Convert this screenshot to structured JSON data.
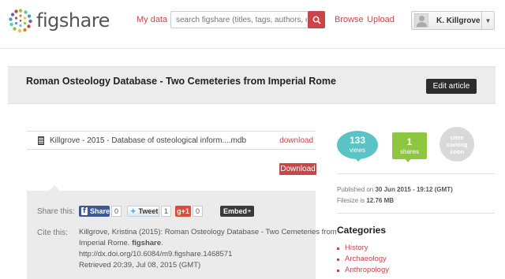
{
  "header": {
    "logo_text": "figshare",
    "nav": {
      "my_data": "My data",
      "browse": "Browse",
      "upload": "Upload"
    },
    "search": {
      "placeholder": "search figshare (titles, tags, authors, etc.)"
    },
    "user": {
      "name": "K. Killgrove"
    }
  },
  "article": {
    "title": "Roman Osteology Database - Two Cemeteries from Imperial Rome",
    "edit_label": "Edit article"
  },
  "file": {
    "name": "Killgrove - 2015 - Database of osteological inform....mdb",
    "download_link": "download",
    "download_button": "Download"
  },
  "share": {
    "share_label": "Share this:",
    "facebook_label": "Share",
    "facebook_count": "0",
    "tweet_label": "Tweet",
    "tweet_count": "1",
    "gplus_label": "g+1",
    "gplus_count": "0",
    "embed_label": "Embed",
    "cite_label": "Cite this:",
    "citation_line1": "Killgrove, Kristina (2015): Roman Osteology Database - Two Cemeteries from",
    "citation_line2_prefix": "Imperial Rome. ",
    "citation_line2_bold": "figshare",
    "citation_line2_suffix": ".",
    "citation_doi": "http://dx.doi.org/10.6084/m9.figshare.1468571",
    "citation_retrieved": "Retrieved 20:39, Jul 08, 2015 (GMT)"
  },
  "stats": {
    "views_count": "133",
    "views_label": "views",
    "shares_count": "1",
    "shares_label": "shares",
    "cites_line1": "cites",
    "cites_line2": "coming",
    "cites_line3": "soon"
  },
  "meta": {
    "published_prefix": "Published on ",
    "published_value": "30 Jun 2015 - 19:12 (GMT)",
    "filesize_prefix": "Filesize is ",
    "filesize_value": "12.76 MB"
  },
  "categories": {
    "title": "Categories",
    "items": [
      "History",
      "Archaeology",
      "Anthropology"
    ]
  },
  "colors": {
    "accent": "#c8464a",
    "views": "#59c3c5",
    "shares": "#8dc63f",
    "dark_button": "#2d2d2d"
  }
}
